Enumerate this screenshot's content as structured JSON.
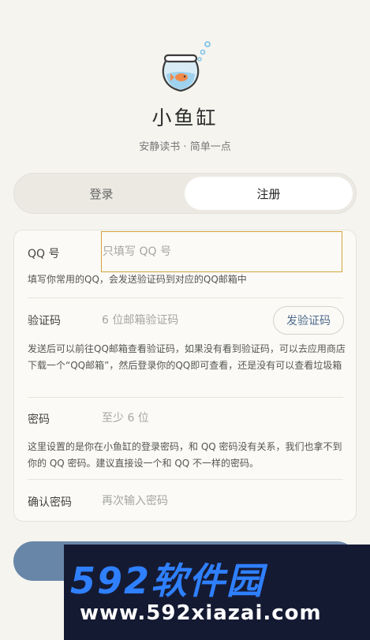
{
  "app": {
    "name": "小鱼缸",
    "slogan": "安静读书 · 简单一点"
  },
  "tabs": [
    {
      "label": "登录",
      "selected": false
    },
    {
      "label": "注册",
      "selected": true
    }
  ],
  "form": {
    "qq": {
      "label": "QQ 号",
      "placeholder": "只填写 QQ 号",
      "hint": "填写你常用的QQ，会发送验证码到对应的QQ邮箱中"
    },
    "code": {
      "label": "验证码",
      "placeholder": "6 位邮箱验证码",
      "button": "发验证码",
      "hint": "发送后可以前往QQ邮箱查看验证码，如果没有看到验证码，可以去应用商店下载一个“QQ邮箱”，然后登录你的QQ即可查看，还是没有可以查看垃圾箱"
    },
    "password": {
      "label": "密码",
      "placeholder": "至少 6 位",
      "hint": "这里设置的是你在小鱼缸的登录密码，和 QQ 密码没有关系，我们也拿不到你的 QQ 密码。建议直接设一个和 QQ 不一样的密码。"
    },
    "confirm": {
      "label": "确认密码",
      "placeholder": "再次输入密码"
    }
  },
  "watermark": {
    "title": "592软件园",
    "url": "www.592xiazai.com"
  },
  "colors": {
    "background": "#f5f4ef",
    "accent": "#6886a8",
    "focus_border": "#d2a43a",
    "code_button_text": "#4f6b8d"
  },
  "icons": {
    "logo": "fishbowl-icon"
  }
}
